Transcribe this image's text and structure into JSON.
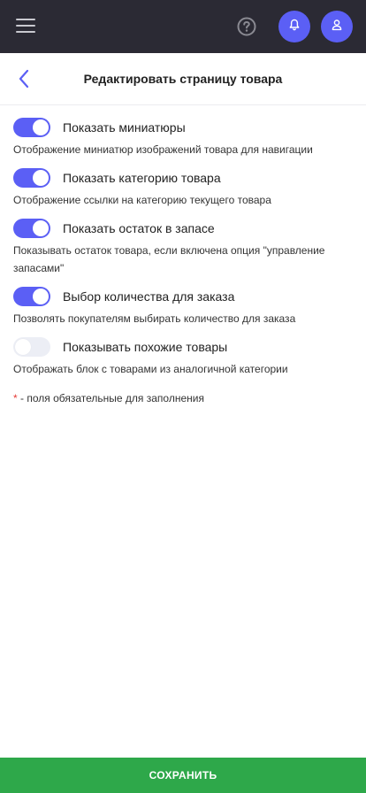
{
  "colors": {
    "accent": "#5b5ff5",
    "topbar": "#2b2a34",
    "save": "#2ea84a",
    "required": "#e53935"
  },
  "topbar": {
    "menu_icon": "hamburger-icon",
    "help_icon": "question-circle-icon",
    "notifications_icon": "bell-icon",
    "profile_icon": "user-icon"
  },
  "header": {
    "back_icon": "chevron-left-icon",
    "title": "Редактировать страницу товара"
  },
  "settings": [
    {
      "label": "Показать миниатюры",
      "description": "Отображение миниатюр изображений товара для навигации",
      "enabled": true
    },
    {
      "label": "Показать категорию товара",
      "description": "Отображение ссылки на категорию текущего товара",
      "enabled": true
    },
    {
      "label": "Показать остаток в запасе",
      "description": "Показывать остаток товара, если включена опция \"управление запасами\"",
      "enabled": true
    },
    {
      "label": "Выбор количества для заказа",
      "description": "Позволять покупателям выбирать количество для заказа",
      "enabled": true
    },
    {
      "label": "Показывать похожие товары",
      "description": "Отображать блок с товарами из аналогичной категории",
      "enabled": false
    }
  ],
  "footnote": {
    "star": "*",
    "text": " - поля обязательные для заполнения"
  },
  "save_label": "СОХРАНИТЬ"
}
